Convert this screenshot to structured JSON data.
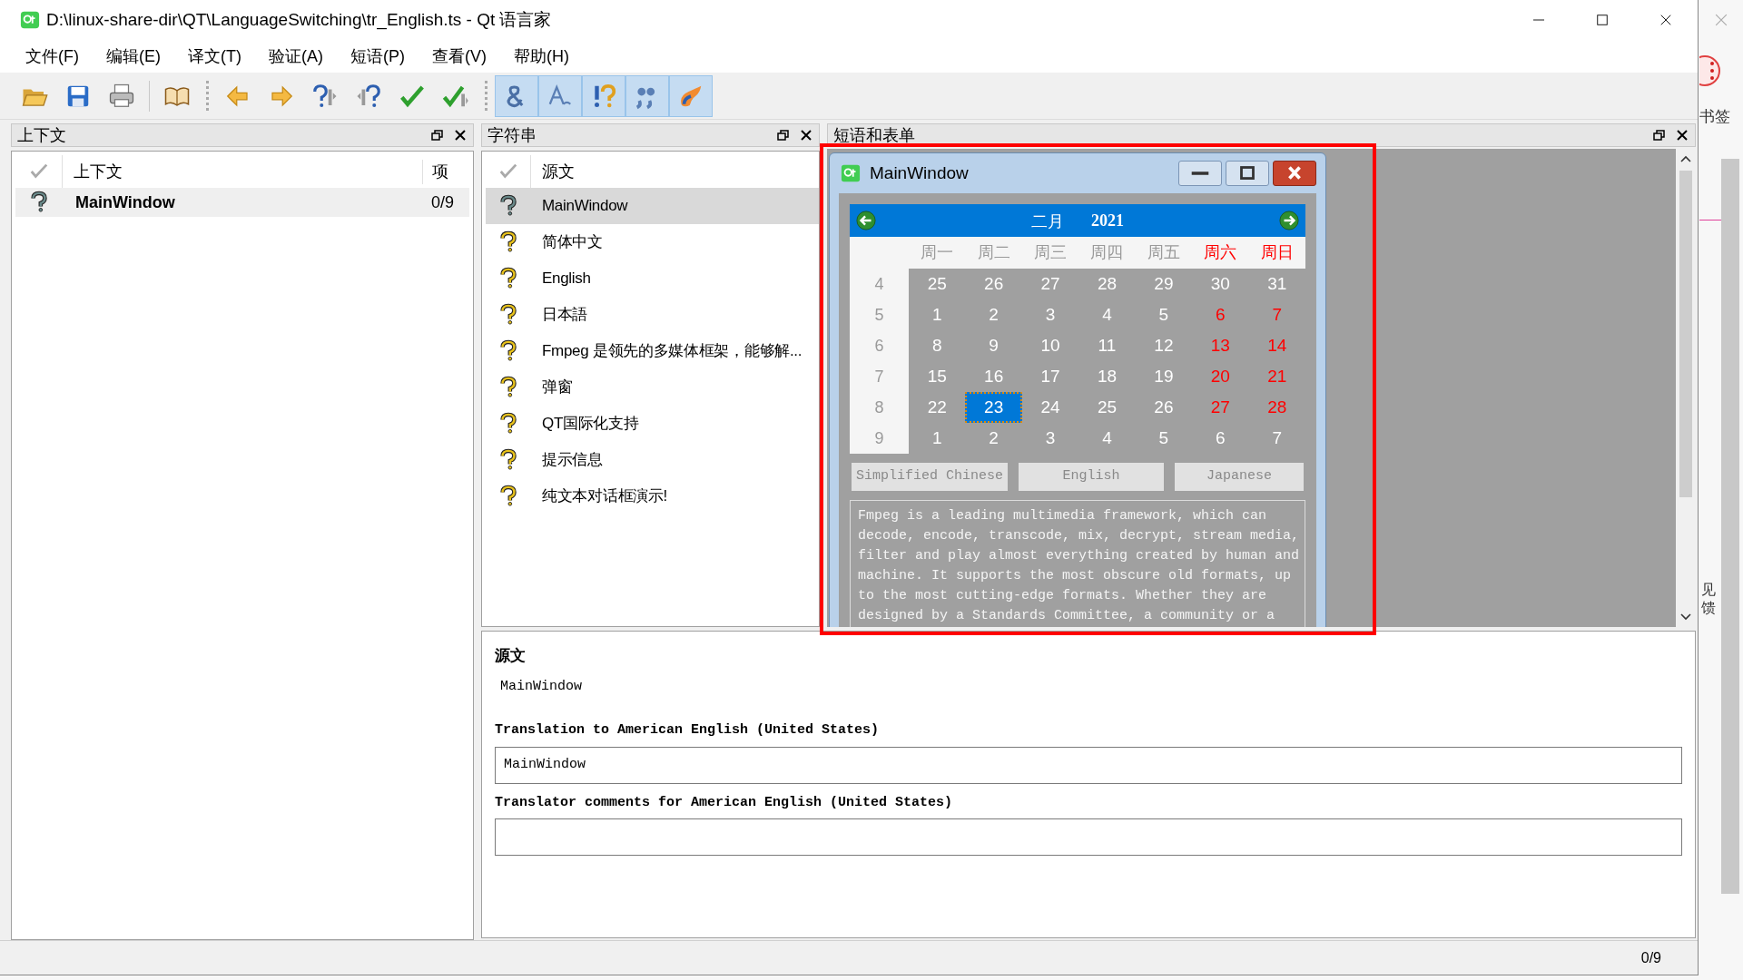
{
  "window": {
    "title": "D:\\linux-share-dir\\QT\\LanguageSwitching\\tr_English.ts - Qt 语言家"
  },
  "menu": [
    "文件(F)",
    "编辑(E)",
    "译文(T)",
    "验证(A)",
    "短语(P)",
    "查看(V)",
    "帮助(H)"
  ],
  "toolbar": [
    {
      "kind": "open",
      "on": false
    },
    {
      "kind": "save",
      "on": false
    },
    {
      "kind": "print",
      "on": false
    },
    {
      "kind": "sep"
    },
    {
      "kind": "book",
      "on": false
    },
    {
      "kind": "group"
    },
    {
      "kind": "prev",
      "on": false
    },
    {
      "kind": "next",
      "on": false
    },
    {
      "kind": "prev-todo",
      "on": false
    },
    {
      "kind": "next-todo",
      "on": false
    },
    {
      "kind": "done",
      "on": false
    },
    {
      "kind": "done-next",
      "on": false
    },
    {
      "kind": "group"
    },
    {
      "kind": "ampersand",
      "on": true
    },
    {
      "kind": "letter",
      "on": true
    },
    {
      "kind": "exclaim",
      "on": true
    },
    {
      "kind": "quotes",
      "on": true
    },
    {
      "kind": "flame",
      "on": true
    }
  ],
  "context_dock": {
    "title": "上下文",
    "columns": [
      "上下文",
      "项"
    ],
    "rows": [
      {
        "kind": "partial",
        "name": "MainWindow",
        "count": "0/9",
        "selected": true
      }
    ]
  },
  "strings_dock": {
    "title": "字符串",
    "column": "源文",
    "rows": [
      {
        "kind": "partial",
        "text": "MainWindow",
        "selected": true
      },
      {
        "kind": "untranslated",
        "text": "简体中文",
        "selected": false
      },
      {
        "kind": "untranslated",
        "text": "English",
        "selected": false
      },
      {
        "kind": "untranslated",
        "text": "日本語",
        "selected": false
      },
      {
        "kind": "untranslated",
        "text": "Fmpeg 是领先的多媒体框架，能够解...",
        "selected": false
      },
      {
        "kind": "untranslated",
        "text": "弹窗",
        "selected": false
      },
      {
        "kind": "untranslated",
        "text": "QT国际化支持",
        "selected": false
      },
      {
        "kind": "untranslated",
        "text": "提示信息",
        "selected": false
      },
      {
        "kind": "untranslated",
        "text": "纯文本对话框演示!",
        "selected": false
      }
    ]
  },
  "phrases_dock": {
    "title": "短语和表单",
    "form": {
      "title": "MainWindow",
      "month": "二月",
      "year": "2021",
      "weekdays": [
        {
          "text": "周一",
          "weekend": false
        },
        {
          "text": "周二",
          "weekend": false
        },
        {
          "text": "周三",
          "weekend": false
        },
        {
          "text": "周四",
          "weekend": false
        },
        {
          "text": "周五",
          "weekend": false
        },
        {
          "text": "周六",
          "weekend": true
        },
        {
          "text": "周日",
          "weekend": true
        }
      ],
      "weeks": [
        {
          "number": "4",
          "days": [
            {
              "text": "25",
              "weekend": false,
              "selected": false
            },
            {
              "text": "26",
              "weekend": false,
              "selected": false
            },
            {
              "text": "27",
              "weekend": false,
              "selected": false
            },
            {
              "text": "28",
              "weekend": false,
              "selected": false
            },
            {
              "text": "29",
              "weekend": false,
              "selected": false
            },
            {
              "text": "30",
              "weekend": false,
              "selected": false
            },
            {
              "text": "31",
              "weekend": false,
              "selected": false
            }
          ]
        },
        {
          "number": "5",
          "days": [
            {
              "text": "1",
              "weekend": false,
              "selected": false
            },
            {
              "text": "2",
              "weekend": false,
              "selected": false
            },
            {
              "text": "3",
              "weekend": false,
              "selected": false
            },
            {
              "text": "4",
              "weekend": false,
              "selected": false
            },
            {
              "text": "5",
              "weekend": false,
              "selected": false
            },
            {
              "text": "6",
              "weekend": true,
              "selected": false
            },
            {
              "text": "7",
              "weekend": true,
              "selected": false
            }
          ]
        },
        {
          "number": "6",
          "days": [
            {
              "text": "8",
              "weekend": false,
              "selected": false
            },
            {
              "text": "9",
              "weekend": false,
              "selected": false
            },
            {
              "text": "10",
              "weekend": false,
              "selected": false
            },
            {
              "text": "11",
              "weekend": false,
              "selected": false
            },
            {
              "text": "12",
              "weekend": false,
              "selected": false
            },
            {
              "text": "13",
              "weekend": true,
              "selected": false
            },
            {
              "text": "14",
              "weekend": true,
              "selected": false
            }
          ]
        },
        {
          "number": "7",
          "days": [
            {
              "text": "15",
              "weekend": false,
              "selected": false
            },
            {
              "text": "16",
              "weekend": false,
              "selected": false
            },
            {
              "text": "17",
              "weekend": false,
              "selected": false
            },
            {
              "text": "18",
              "weekend": false,
              "selected": false
            },
            {
              "text": "19",
              "weekend": false,
              "selected": false
            },
            {
              "text": "20",
              "weekend": true,
              "selected": false
            },
            {
              "text": "21",
              "weekend": true,
              "selected": false
            }
          ]
        },
        {
          "number": "8",
          "days": [
            {
              "text": "22",
              "weekend": false,
              "selected": false
            },
            {
              "text": "23",
              "weekend": false,
              "selected": true
            },
            {
              "text": "24",
              "weekend": false,
              "selected": false
            },
            {
              "text": "25",
              "weekend": false,
              "selected": false
            },
            {
              "text": "26",
              "weekend": false,
              "selected": false
            },
            {
              "text": "27",
              "weekend": true,
              "selected": false
            },
            {
              "text": "28",
              "weekend": true,
              "selected": false
            }
          ]
        },
        {
          "number": "9",
          "days": [
            {
              "text": "1",
              "weekend": false,
              "selected": false
            },
            {
              "text": "2",
              "weekend": false,
              "selected": false
            },
            {
              "text": "3",
              "weekend": false,
              "selected": false
            },
            {
              "text": "4",
              "weekend": false,
              "selected": false
            },
            {
              "text": "5",
              "weekend": false,
              "selected": false
            },
            {
              "text": "6",
              "weekend": false,
              "selected": false
            },
            {
              "text": "7",
              "weekend": false,
              "selected": false
            }
          ]
        }
      ],
      "buttons": [
        "Simplified Chinese",
        "English",
        "Japanese"
      ],
      "text": "Fmpeg is a leading multimedia framework, which can decode, encode, transcode, mix, decrypt, stream media, filter and play almost everything created by human and machine. It supports the most obscure old formats, up to the most cutting-edge formats. Whether they are designed by a Standards Committee, a community or a"
    }
  },
  "editor": {
    "source_label": "源文",
    "source": "MainWindow",
    "translation_label": "Translation to American English (United States)",
    "translation": "MainWindow",
    "comments_label": "Translator comments for American English (United States)"
  },
  "status_bar": {
    "progress": "0/9"
  },
  "annotations": [
    {
      "kind": "frame"
    }
  ],
  "background": {
    "bookmarks": "书签",
    "side_texts": [
      "见",
      "馈"
    ]
  }
}
